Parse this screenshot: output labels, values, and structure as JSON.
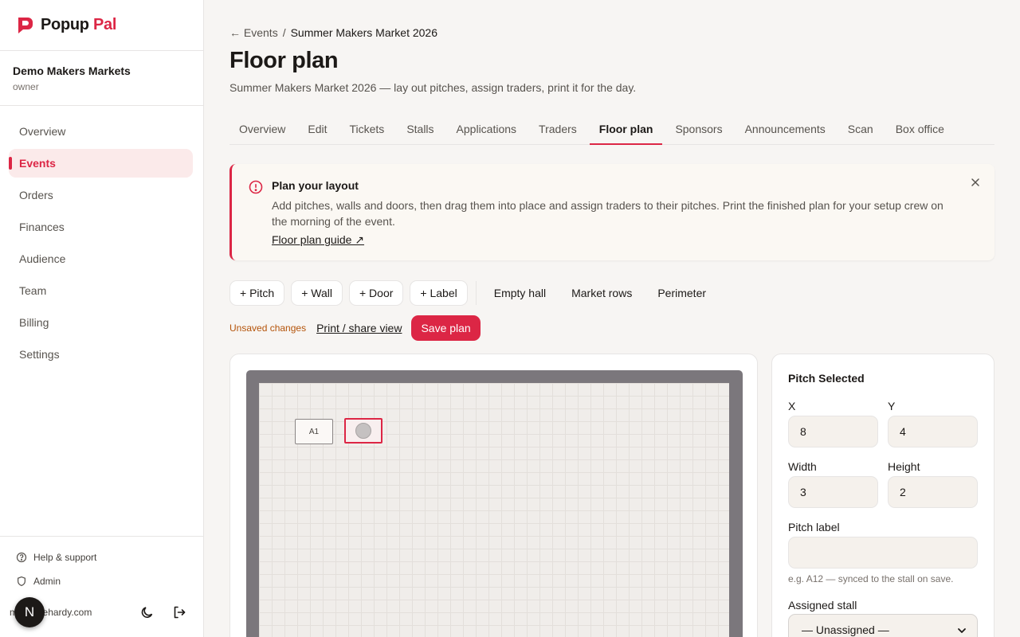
{
  "brand": {
    "name_part1": "Popup",
    "name_part2": "Pal"
  },
  "org": {
    "name": "Demo Makers Markets",
    "role": "owner"
  },
  "nav": [
    {
      "label": "Overview",
      "active": false
    },
    {
      "label": "Events",
      "active": true
    },
    {
      "label": "Orders",
      "active": false
    },
    {
      "label": "Finances",
      "active": false
    },
    {
      "label": "Audience",
      "active": false
    },
    {
      "label": "Team",
      "active": false
    },
    {
      "label": "Billing",
      "active": false
    },
    {
      "label": "Settings",
      "active": false
    }
  ],
  "footer": {
    "help": "Help & support",
    "admin": "Admin",
    "email": "m@codehardy.com",
    "avatar_initial": "N"
  },
  "breadcrumb": {
    "back": "← Events",
    "separator": "/",
    "current": "Summer Makers Market 2026"
  },
  "page": {
    "title": "Floor plan",
    "subtitle": "Summer Makers Market 2026 — lay out pitches, assign traders, print it for the day."
  },
  "tabs": [
    {
      "label": "Overview",
      "active": false
    },
    {
      "label": "Edit",
      "active": false
    },
    {
      "label": "Tickets",
      "active": false
    },
    {
      "label": "Stalls",
      "active": false
    },
    {
      "label": "Applications",
      "active": false
    },
    {
      "label": "Traders",
      "active": false
    },
    {
      "label": "Floor plan",
      "active": true
    },
    {
      "label": "Sponsors",
      "active": false
    },
    {
      "label": "Announcements",
      "active": false
    },
    {
      "label": "Scan",
      "active": false
    },
    {
      "label": "Box office",
      "active": false
    }
  ],
  "alert": {
    "title": "Plan your layout",
    "body": "Add pitches, walls and doors, then drag them into place and assign traders to their pitches. Print the finished plan for your setup crew on the morning of the event.",
    "link": "Floor plan guide ↗"
  },
  "toolbar": {
    "add_pitch": "+ Pitch",
    "add_wall": "+ Wall",
    "add_door": "+ Door",
    "add_label": "+ Label",
    "presets": [
      "Empty hall",
      "Market rows",
      "Perimeter"
    ]
  },
  "savebar": {
    "status": "Unsaved changes",
    "print_link": "Print / share view",
    "save_button": "Save plan"
  },
  "canvas": {
    "pitches": [
      {
        "label": "A1",
        "selected": false
      },
      {
        "label": "",
        "selected": true
      }
    ]
  },
  "panel": {
    "title": "Pitch Selected",
    "x_label": "X",
    "x_value": "8",
    "y_label": "Y",
    "y_value": "4",
    "width_label": "Width",
    "width_value": "3",
    "height_label": "Height",
    "height_value": "2",
    "pitch_label_label": "Pitch label",
    "pitch_label_value": "",
    "pitch_label_hint": "e.g. A12 — synced to the stall on save.",
    "assigned_label": "Assigned stall",
    "assigned_value": "— Unassigned —"
  },
  "colors": {
    "accent": "#dc2645",
    "warning": "#b45309"
  },
  "icons": {
    "logo": "popup-pal-logo",
    "alert": "info-icon",
    "close": "close-icon",
    "help": "help-circle-icon",
    "admin": "shield-icon",
    "theme": "moon-icon",
    "logout": "logout-icon",
    "select": "chevron-down-icon"
  }
}
